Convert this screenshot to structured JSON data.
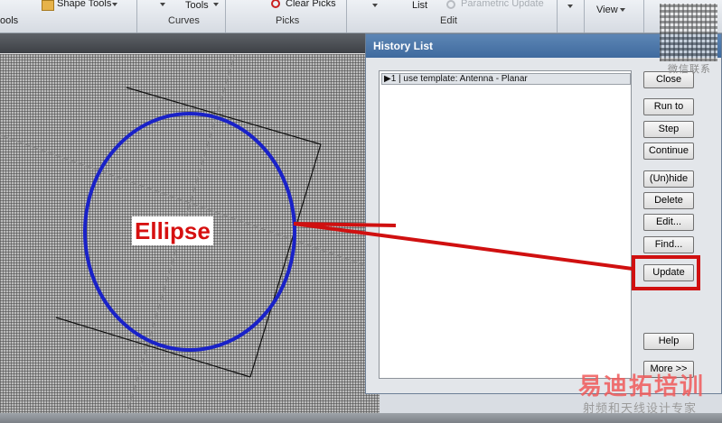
{
  "ribbon": {
    "shape_tools_label": "Shape Tools",
    "tools_left_label": "ools",
    "tools_label": "Tools",
    "curves_group": "Curves",
    "clear_picks_label": "Clear Picks",
    "picks_group": "Picks",
    "list_label": "List",
    "parametric_update_label": "Parametric Update",
    "edit_group": "Edit",
    "view_label": "View"
  },
  "history_dialog": {
    "title": "History List",
    "items": [
      "▶1 | use template: Antenna - Planar"
    ],
    "buttons": {
      "close": "Close",
      "run_to": "Run to",
      "step": "Step",
      "continue": "Continue",
      "unhide": "(Un)hide",
      "delete": "Delete",
      "edit": "Edit...",
      "find": "Find...",
      "update": "Update",
      "help": "Help",
      "more": "More >>"
    }
  },
  "annotation": {
    "label": "Ellipse",
    "color": "#d61010"
  },
  "watermark": {
    "qr_caption": "微信联系",
    "brand": "易迪拓培训",
    "tagline": "射频和天线设计专家"
  },
  "colors": {
    "ellipse": "#1a22c8",
    "highlight": "#d01010",
    "dialog_title": "#4a76aa"
  }
}
